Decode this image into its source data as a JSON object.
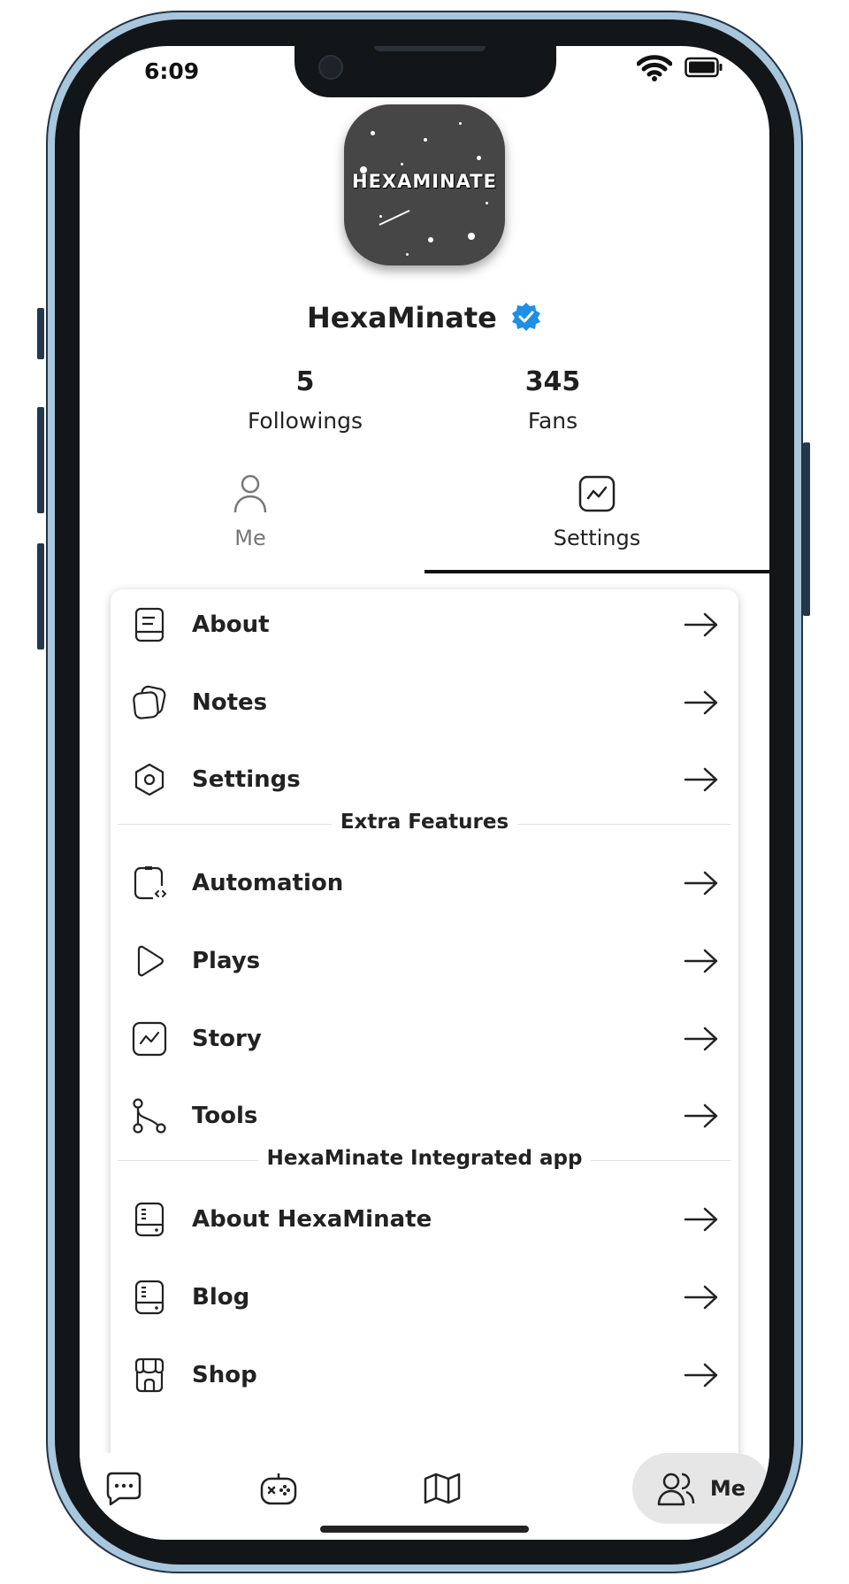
{
  "status_bar": {
    "time": "6:09"
  },
  "profile": {
    "avatar_text": "HEXAMINATE",
    "username": "HexaMinate",
    "verified_color": "#1d8fe8"
  },
  "stats": [
    {
      "value": "5",
      "label": "Followings"
    },
    {
      "value": "345",
      "label": "Fans"
    }
  ],
  "tabs": [
    {
      "label": "Me",
      "icon": "user-icon",
      "active": false
    },
    {
      "label": "Settings",
      "icon": "chart-icon",
      "active": true
    }
  ],
  "menu": {
    "main": [
      {
        "label": "About",
        "icon": "document-icon"
      },
      {
        "label": "Notes",
        "icon": "notes-icon"
      },
      {
        "label": "Settings",
        "icon": "hexagon-settings-icon"
      }
    ],
    "extra_title": "Extra Features",
    "extra": [
      {
        "label": "Automation",
        "icon": "device-code-icon"
      },
      {
        "label": "Plays",
        "icon": "play-icon"
      },
      {
        "label": "Story",
        "icon": "chart-icon"
      },
      {
        "label": "Tools",
        "icon": "git-branch-icon"
      }
    ],
    "integrated_title": "HexaMinate Integrated app",
    "integrated": [
      {
        "label": "About HexaMinate",
        "icon": "server-icon"
      },
      {
        "label": "Blog",
        "icon": "server-icon"
      },
      {
        "label": "Shop",
        "icon": "shop-icon"
      }
    ]
  },
  "bottom_nav": [
    {
      "name": "chat",
      "icon": "chat-icon"
    },
    {
      "name": "games",
      "icon": "gamepad-icon"
    },
    {
      "name": "map",
      "icon": "map-icon"
    },
    {
      "name": "me",
      "icon": "users-icon",
      "label": "Me",
      "active": true
    }
  ]
}
